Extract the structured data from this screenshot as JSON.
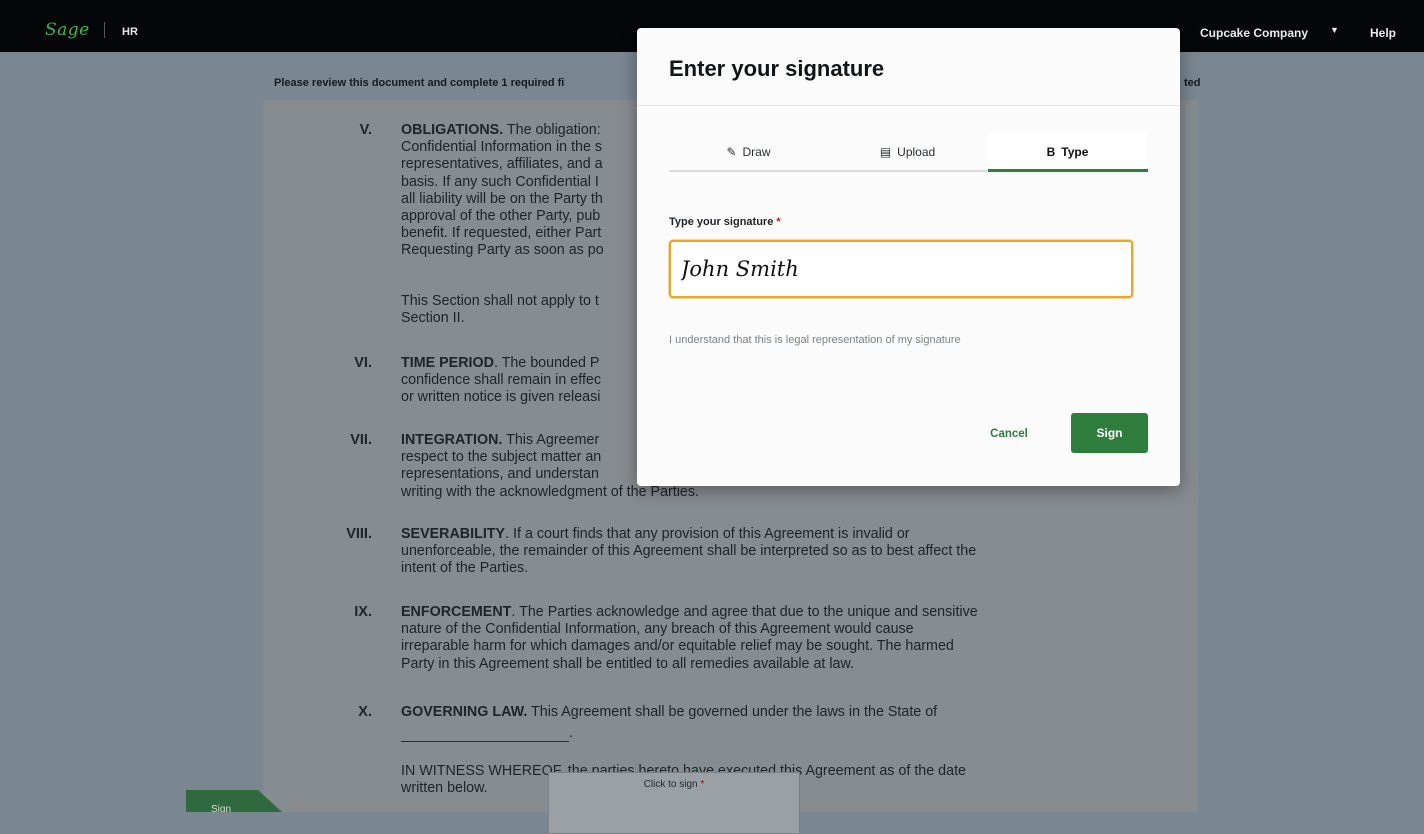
{
  "topbar": {
    "logo": "Sage",
    "module": "HR",
    "company": "Cupcake Company",
    "help": "Help"
  },
  "document": {
    "instruction_left": "Please review this document and complete 1 required fi",
    "instruction_right": "ted",
    "clauses": [
      {
        "num": "V.",
        "lines": [
          "<b>OBLIGATIONS.</b> The obligation:",
          "Confidential Information in the s",
          "representatives, affiliates, and a",
          "basis. If any such Confidential I",
          "all liability will be on the Party th",
          "approval of the other Party, pub",
          "benefit. If requested, either Part",
          "Requesting Party as soon as po"
        ]
      },
      {
        "num": "",
        "lines": [
          "This Section shall not apply to t",
          "Section II."
        ]
      },
      {
        "num": "VI.",
        "lines": [
          "<b>TIME PERIOD</b>. The bounded P",
          "confidence shall remain in effec",
          "or written notice is given releasi"
        ]
      },
      {
        "num": "VII.",
        "lines": [
          "<b>INTEGRATION.</b> This Agreemer",
          "respect to the subject matter an",
          "representations, and understan",
          "writing with the acknowledgment of the Parties."
        ]
      },
      {
        "num": "VIII.",
        "lines": [
          "<b>SEVERABILITY</b>. If a court finds that any provision of this Agreement is invalid or",
          "unenforceable, the remainder of this Agreement shall be interpreted so as to best affect the",
          "intent of the Parties."
        ]
      },
      {
        "num": "IX.",
        "lines": [
          "<b>ENFORCEMENT</b>. The Parties acknowledge and agree that due to the unique and sensitive",
          "nature of the Confidential Information, any breach of this Agreement would cause",
          "irreparable harm for which damages and/or equitable relief may be sought. The harmed",
          "Party in this Agreement shall be entitled to all remedies available at law."
        ]
      },
      {
        "num": "X.",
        "lines": [
          "<b>GOVERNING LAW.</b> This Agreement shall be governed under the laws in the State of"
        ]
      }
    ],
    "governing_tail": ".",
    "witness_line1": "IN WITNESS WHEREOF, the parties hereto have executed this Agreement as of the date",
    "witness_line2": "written below.",
    "click_to_sign": "Click to sign",
    "sign_flag": "Sign"
  },
  "modal": {
    "title": "Enter your signature",
    "tabs": [
      {
        "label": "Draw",
        "icon": "pencil-icon",
        "glyph": "✎"
      },
      {
        "label": "Upload",
        "icon": "file-icon",
        "glyph": "▤"
      },
      {
        "label": "Type",
        "icon": "bold-icon",
        "glyph": "B"
      }
    ],
    "active_tab": "Type",
    "field_label": "Type your signature",
    "required_marker": "*",
    "signature_value": "John Smith",
    "legal_note": "I understand that this is legal representation of my signature",
    "cancel_label": "Cancel",
    "sign_label": "Sign"
  }
}
